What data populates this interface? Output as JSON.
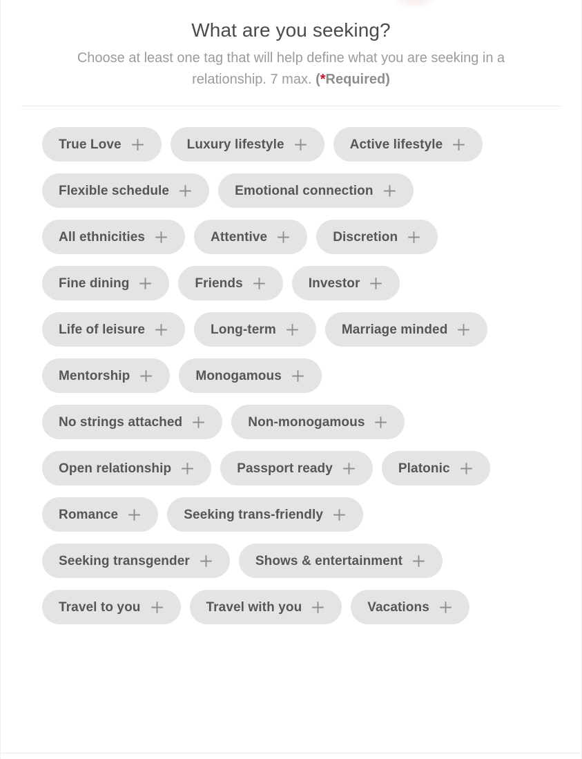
{
  "header": {
    "title": "What are you seeking?",
    "subtitle_text": "Choose at least one tag that will help define what you are seeking in a relationship. 7 max. ",
    "required_open_paren": "(",
    "required_asterisk": "*",
    "required_word": "Required",
    "required_close_paren": ")"
  },
  "colors": {
    "title_text": "#4b4b4b",
    "subtitle_text": "#9b9b9b",
    "required_red": "#c8102e",
    "tag_background": "#e4e4e4",
    "tag_text": "#565656",
    "plus_icon": "#8e8e8e",
    "divider": "#e6e6e6",
    "page_background": "#ffffff"
  },
  "tags": [
    {
      "label": "True Love",
      "icon": "plus-icon",
      "selected": false
    },
    {
      "label": "Luxury lifestyle",
      "icon": "plus-icon",
      "selected": false
    },
    {
      "label": "Active lifestyle",
      "icon": "plus-icon",
      "selected": false
    },
    {
      "label": "Flexible schedule",
      "icon": "plus-icon",
      "selected": false
    },
    {
      "label": "Emotional connection",
      "icon": "plus-icon",
      "selected": false
    },
    {
      "label": "All ethnicities",
      "icon": "plus-icon",
      "selected": false
    },
    {
      "label": "Attentive",
      "icon": "plus-icon",
      "selected": false
    },
    {
      "label": "Discretion",
      "icon": "plus-icon",
      "selected": false
    },
    {
      "label": "Fine dining",
      "icon": "plus-icon",
      "selected": false
    },
    {
      "label": "Friends",
      "icon": "plus-icon",
      "selected": false
    },
    {
      "label": "Investor",
      "icon": "plus-icon",
      "selected": false
    },
    {
      "label": "Life of leisure",
      "icon": "plus-icon",
      "selected": false
    },
    {
      "label": "Long-term",
      "icon": "plus-icon",
      "selected": false
    },
    {
      "label": "Marriage minded",
      "icon": "plus-icon",
      "selected": false
    },
    {
      "label": "Mentorship",
      "icon": "plus-icon",
      "selected": false
    },
    {
      "label": "Monogamous",
      "icon": "plus-icon",
      "selected": false
    },
    {
      "label": "No strings attached",
      "icon": "plus-icon",
      "selected": false
    },
    {
      "label": "Non-monogamous",
      "icon": "plus-icon",
      "selected": false
    },
    {
      "label": "Open relationship",
      "icon": "plus-icon",
      "selected": false
    },
    {
      "label": "Passport ready",
      "icon": "plus-icon",
      "selected": false
    },
    {
      "label": "Platonic",
      "icon": "plus-icon",
      "selected": false
    },
    {
      "label": "Romance",
      "icon": "plus-icon",
      "selected": false
    },
    {
      "label": "Seeking trans-friendly",
      "icon": "plus-icon",
      "selected": false
    },
    {
      "label": "Seeking transgender",
      "icon": "plus-icon",
      "selected": false
    },
    {
      "label": "Shows & entertainment",
      "icon": "plus-icon",
      "selected": false
    },
    {
      "label": "Travel to you",
      "icon": "plus-icon",
      "selected": false
    },
    {
      "label": "Travel with you",
      "icon": "plus-icon",
      "selected": false
    },
    {
      "label": "Vacations",
      "icon": "plus-icon",
      "selected": false
    }
  ]
}
